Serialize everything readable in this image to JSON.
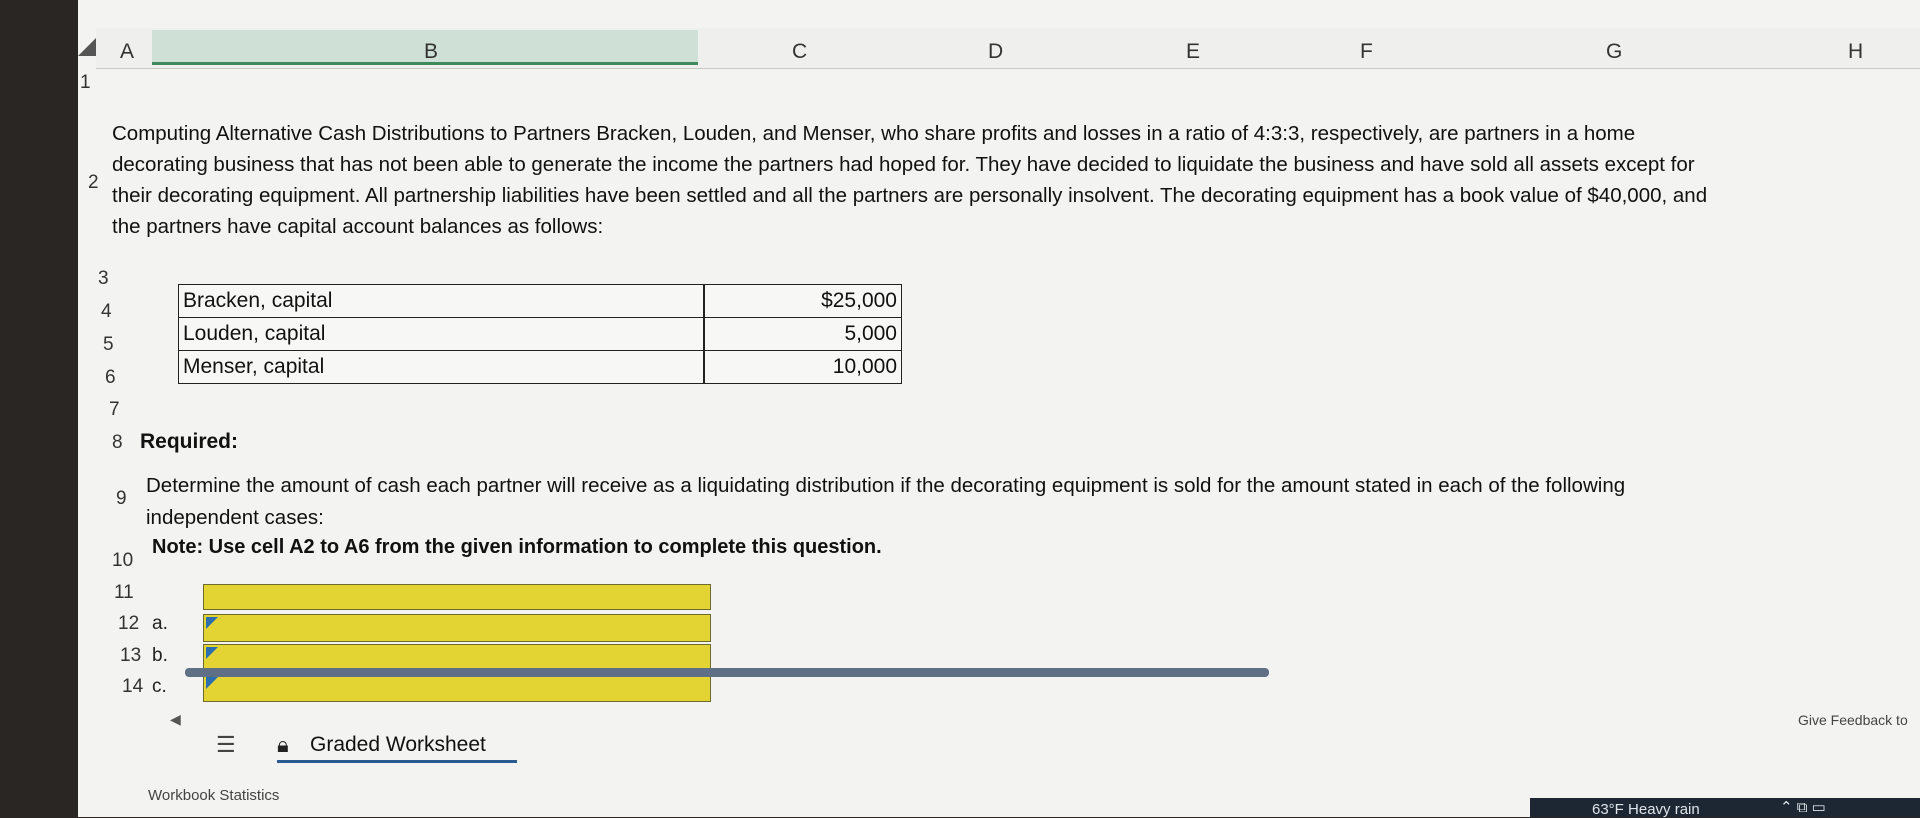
{
  "columns": [
    "A",
    "B",
    "C",
    "D",
    "E",
    "F",
    "G",
    "H"
  ],
  "rows": {
    "r1": "1",
    "r2": "2",
    "r3": "3",
    "r4": "4",
    "r5": "5",
    "r6": "6",
    "r7": "7",
    "r8": "8",
    "r9": "9",
    "r10": "10",
    "r11": "11",
    "r12": "12",
    "r13": "13",
    "r14": "14"
  },
  "problem": {
    "line1": "Computing Alternative Cash Distributions to Partners Bracken, Louden, and Menser, who share profits and losses in a ratio of 4:3:3, respectively, are partners in a home",
    "line2": "decorating business that has not been able to generate the income the partners had hoped for. They have decided to liquidate the business and have sold all assets except for",
    "line3": "their decorating equipment. All partnership liabilities have been settled and all the partners are personally insolvent. The decorating equipment has a book value of $40,000, and",
    "line4": "the partners have capital account balances as follows:"
  },
  "capital_table": [
    {
      "name": "Bracken, capital",
      "amount": "$25,000"
    },
    {
      "name": "Louden, capital",
      "amount": "5,000"
    },
    {
      "name": "Menser, capital",
      "amount": "10,000"
    }
  ],
  "required_label": "Required:",
  "determine": {
    "line1": "Determine the amount of cash each partner will receive as a liquidating distribution if the decorating equipment is sold for the amount stated in each of the following",
    "line2": "independent cases:"
  },
  "note": "Note: Use cell A2 to A6 from the given information to complete this question.",
  "answers": [
    {
      "label": "a."
    },
    {
      "label": "b."
    },
    {
      "label": "c."
    }
  ],
  "sheet_tab": "Graded Worksheet",
  "feedback": "Give Feedback to",
  "workbook_stats": "Workbook Statistics",
  "taskbar": {
    "weather": "63°F  Heavy rain"
  },
  "colors": {
    "answer_fill": "#e3d333",
    "selected_column": "#cfe1d6",
    "accent": "#3f8a5c"
  }
}
